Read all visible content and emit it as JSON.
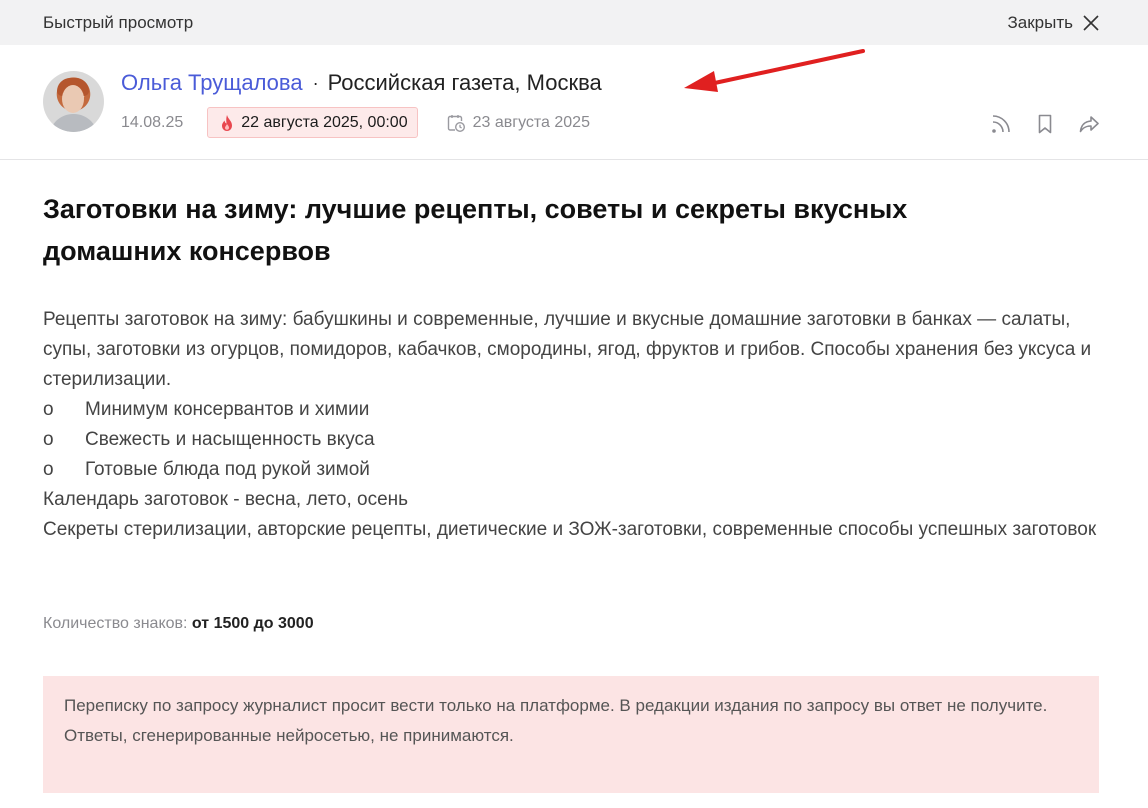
{
  "topbar": {
    "title": "Быстрый просмотр",
    "close_label": "Закрыть"
  },
  "request": {
    "author": "Ольга Трущалова",
    "separator": "·",
    "outlet": "Российская газета, Москва",
    "created_date": "14.08.25",
    "deadline": "22 августа 2025, 00:00",
    "publication_date": "23 августа 2025",
    "title": "Заготовки на зиму: лучшие рецепты, советы и секреты вкусных домашних консервов",
    "intro": "Рецепты заготовок на зиму: бабушкины и современные, лучшие и вкусные домашние заготовки в банках — салаты, супы, заготовки из огурцов, помидоров, кабачков, смородины, ягод, фруктов и грибов. Способы хранения без уксуса и стерилизации.",
    "bullets": [
      {
        "mark": "o",
        "text": "Минимум консервантов и химии"
      },
      {
        "mark": "o",
        "text": "Свежесть и насыщенность вкуса"
      },
      {
        "mark": "o",
        "text": "Готовые блюда под рукой зимой"
      }
    ],
    "calendar_line": "Календарь заготовок - весна, лето, осень",
    "secrets_line": "Секреты стерилизации, авторские рецепты, диетические и ЗОЖ-заготовки, современные способы успешных заготовок",
    "chars_label": "Количество знаков:",
    "chars_value": "от 1500 до 3000"
  },
  "notice": {
    "line1": "Переписку по запросу журналист просит вести только на платформе. В редакции издания по запросу вы ответ не получите.",
    "line2": "Ответы, сгенерированные нейросетью, не принимаются."
  },
  "icons": {
    "deadline": "flame-icon",
    "publication": "calendar-clock-icon",
    "rss": "rss-icon",
    "bookmark": "bookmark-icon",
    "share": "share-icon",
    "close": "close-icon"
  },
  "colors": {
    "author_link": "#4a5bd8",
    "deadline_bg": "#fdeaea",
    "deadline_icon": "#e8474f",
    "notice_bg": "#fce4e4",
    "annotation_arrow": "#e02020"
  }
}
